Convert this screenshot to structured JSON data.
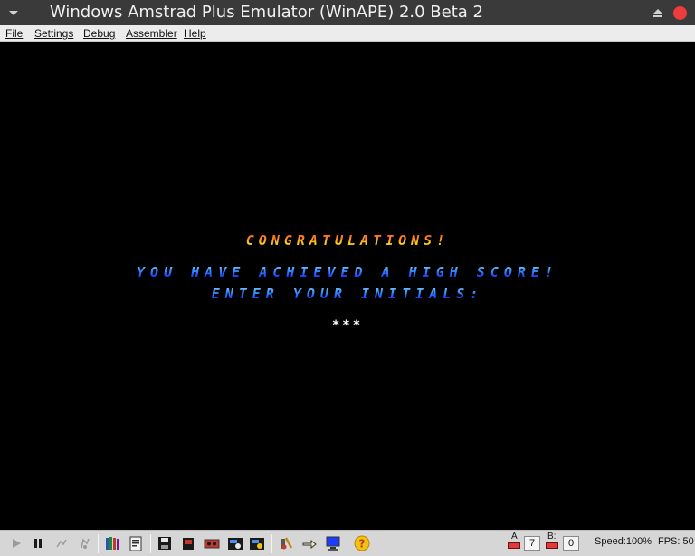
{
  "window": {
    "title": "Windows Amstrad Plus Emulator (WinAPE) 2.0 Beta 2",
    "close_color": "#ee3b3b"
  },
  "menu": {
    "items": [
      "File",
      "Settings",
      "Debug",
      "Assembler",
      "Help"
    ]
  },
  "screen": {
    "congrats": "CONGRATULATIONS!",
    "high_score": "YOU HAVE ACHIEVED A HIGH SCORE!",
    "prompt": "ENTER YOUR INITIALS:",
    "initials": "***",
    "background": "#000000"
  },
  "toolbar": {
    "icons": [
      "play-icon",
      "pause-icon",
      "step-icon",
      "step-over-icon",
      "books-icon",
      "settings-document-icon",
      "save-disk-icon",
      "cartridge-icon",
      "tape-icon",
      "snapshot-icon",
      "snapshot-save-icon",
      "debugger-icon",
      "hand-pointer-icon",
      "monitor-icon",
      "help-icon"
    ],
    "drive_a_label": "A",
    "drive_a_track": "7",
    "drive_b_label": "B:",
    "drive_b_track": "0",
    "speed": "Speed:100%",
    "fps": "FPS: 50"
  }
}
